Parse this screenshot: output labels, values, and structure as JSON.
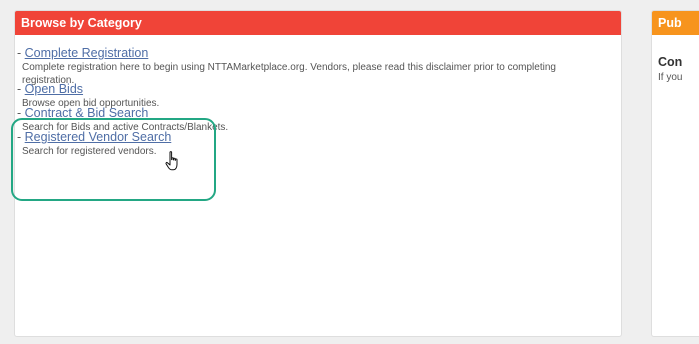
{
  "left_panel": {
    "header": "Browse by Category",
    "items": [
      {
        "link": "Complete Registration",
        "description": "Complete registration here to begin using NTTAMarketplace.org. Vendors, please read this disclaimer prior to completing registration."
      },
      {
        "link": "Open Bids",
        "description": "Browse open bid opportunities."
      },
      {
        "link": "Contract & Bid Search",
        "description": "Search for Bids and active Contracts/Blankets."
      },
      {
        "link": "Registered Vendor Search",
        "description": "Search for registered vendors."
      }
    ],
    "dash": "-"
  },
  "right_panel": {
    "header": "Pub",
    "heading": "Con",
    "text": "If you"
  },
  "colors": {
    "left_header": "#f04438",
    "right_header": "#f7941d",
    "link": "#4f6ea6",
    "highlight": "#23a784"
  },
  "icons": {
    "cursor": "hand-pointer-icon"
  }
}
